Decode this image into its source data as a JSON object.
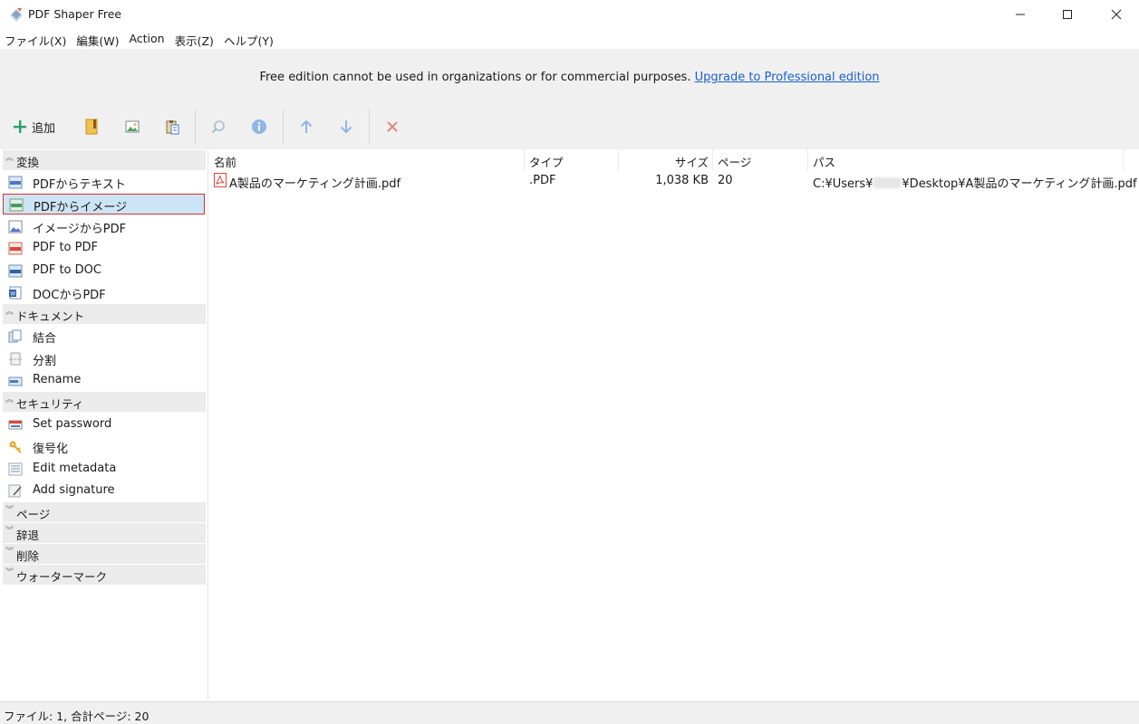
{
  "window": {
    "title": "PDF Shaper Free"
  },
  "menu": [
    {
      "label": "ファイル(X)"
    },
    {
      "label": "編集(W)"
    },
    {
      "label": "Action"
    },
    {
      "label": "表示(Z)"
    },
    {
      "label": "ヘルプ(Y)"
    }
  ],
  "notice": {
    "text": "Free edition cannot be used in organizations or for commercial purposes.",
    "link": "Upgrade to Professional edition"
  },
  "toolbar": {
    "add_label": "追加",
    "icons": [
      "bookmark-icon",
      "image-icon",
      "clipboard-icon",
      "search-icon",
      "info-icon",
      "arrow-up-icon",
      "arrow-down-icon",
      "delete-x-icon"
    ]
  },
  "sidebar": {
    "groups": [
      {
        "title": "変換",
        "expanded": true,
        "items": [
          {
            "label": "PDFからテキスト",
            "icon": "txt-file-icon"
          },
          {
            "label": "PDFからイメージ",
            "icon": "jpg-file-icon",
            "selected": true
          },
          {
            "label": "イメージからPDF",
            "icon": "image-to-pdf-icon"
          },
          {
            "label": "PDF to PDF",
            "icon": "pdf-file-icon"
          },
          {
            "label": "PDF to DOC",
            "icon": "doc-file-icon"
          },
          {
            "label": "DOCからPDF",
            "icon": "word-file-icon"
          }
        ]
      },
      {
        "title": "ドキュメント",
        "expanded": true,
        "items": [
          {
            "label": "結合",
            "icon": "merge-icon"
          },
          {
            "label": "分割",
            "icon": "split-icon"
          },
          {
            "label": "Rename",
            "icon": "rename-icon"
          }
        ]
      },
      {
        "title": "セキュリティ",
        "expanded": true,
        "items": [
          {
            "label": "Set password",
            "icon": "password-icon"
          },
          {
            "label": "復号化",
            "icon": "key-icon"
          },
          {
            "label": "Edit metadata",
            "icon": "metadata-icon"
          },
          {
            "label": "Add signature",
            "icon": "signature-icon"
          }
        ]
      },
      {
        "title": "ページ",
        "expanded": false,
        "items": []
      },
      {
        "title": "辞退",
        "expanded": false,
        "items": []
      },
      {
        "title": "削除",
        "expanded": false,
        "items": []
      },
      {
        "title": "ウォーターマーク",
        "expanded": false,
        "items": []
      }
    ]
  },
  "filelist": {
    "columns": [
      "名前",
      "タイプ",
      "サイズ",
      "ページ",
      "パス"
    ],
    "rows": [
      {
        "name": "A製品のマーケティング計画.pdf",
        "type": ".PDF",
        "size": "1,038 KB",
        "pages": "20",
        "path_prefix": "C:¥Users¥",
        "path_suffix": "¥Desktop¥A製品のマーケティング計画.pdf"
      }
    ]
  },
  "status": {
    "text": "ファイル: 1, 合計ページ: 20"
  },
  "colors": {
    "accent_link": "#1a5fcf",
    "selection_fill": "#cce5f6",
    "selection_border": "#d93030",
    "delete_icon": "#e08a7d",
    "toolbar_icon_blue": "#8fb6e8"
  }
}
